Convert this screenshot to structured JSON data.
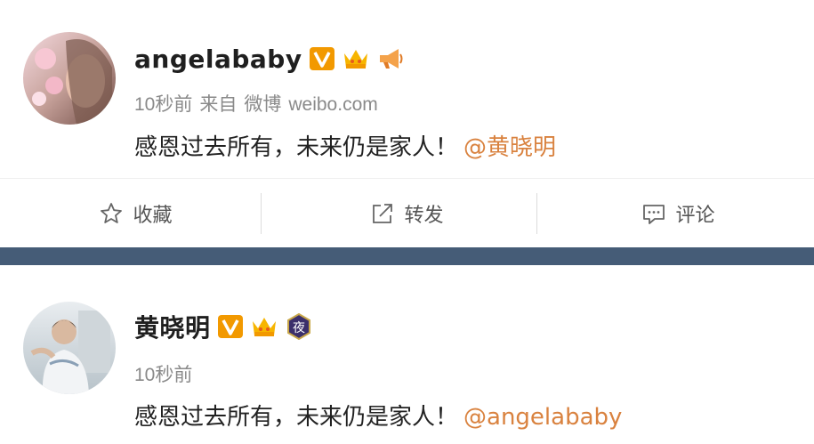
{
  "posts": [
    {
      "author": "angelababy",
      "time": "10秒前",
      "source_prefix": "来自",
      "source_app": "微博",
      "source_site": "weibo.com",
      "text": "感恩过去所有，未来仍是家人！",
      "mention": "@黄晓明"
    },
    {
      "author": "黄晓明",
      "time": "10秒前",
      "text": "感恩过去所有，未来仍是家人！",
      "mention": "@angelababy",
      "night_badge": "夜"
    }
  ],
  "actions": {
    "favorite": "收藏",
    "repost": "转发",
    "comment": "评论"
  },
  "colors": {
    "mention": "#d9823f",
    "verified_badge": "#f29900",
    "separator": "#455c77",
    "meta_text": "#8a8a8a"
  },
  "icons": {
    "verified": "verified-v-icon",
    "crown": "vip-crown-icon",
    "megaphone": "megaphone-icon",
    "night": "night-badge-icon",
    "star": "star-outline-icon",
    "share": "share-arrow-icon",
    "comment": "comment-bubble-icon"
  }
}
